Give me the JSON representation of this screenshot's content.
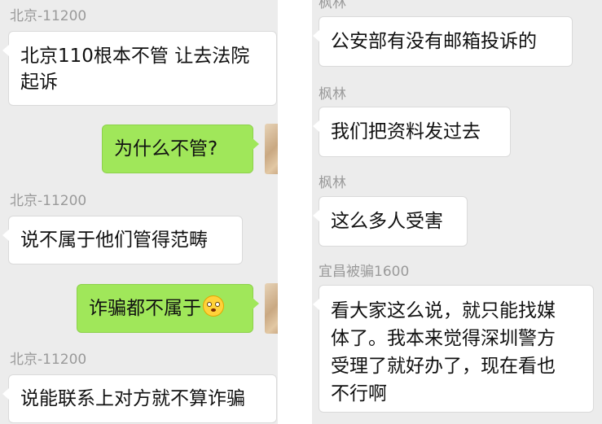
{
  "left": {
    "messages": [
      {
        "sender": "北京-11200",
        "text": "北京110根本不管 让去法院\n起诉",
        "dir": "in"
      },
      {
        "text": "为什么不管?",
        "dir": "out"
      },
      {
        "sender": "北京-11200",
        "text": "说不属于他们管得范畴",
        "dir": "in"
      },
      {
        "text": "诈骗都不属于",
        "dir": "out",
        "emoji": "shocked-face-emoji"
      },
      {
        "sender": "北京-11200",
        "text": "说能联系上对方就不算诈骗",
        "dir": "in"
      }
    ]
  },
  "right": {
    "messages": [
      {
        "sender": "枫林",
        "text": "公安部有没有邮箱投诉的",
        "dir": "in"
      },
      {
        "sender": "枫林",
        "text": "我们把资料发过去",
        "dir": "in"
      },
      {
        "sender": "枫林",
        "text": "这么多人受害",
        "dir": "in"
      },
      {
        "sender": "宜昌被骗1600",
        "text": "看大家这么说，就只能找媒\n体了。我本来觉得深圳警方\n受理了就好办了，现在看也\n不行啊",
        "dir": "in"
      }
    ]
  },
  "colors": {
    "background": "#ececec",
    "sent_bubble": "#a0e75a",
    "received_bubble": "#ffffff",
    "sender_name": "#9a9a9a"
  }
}
